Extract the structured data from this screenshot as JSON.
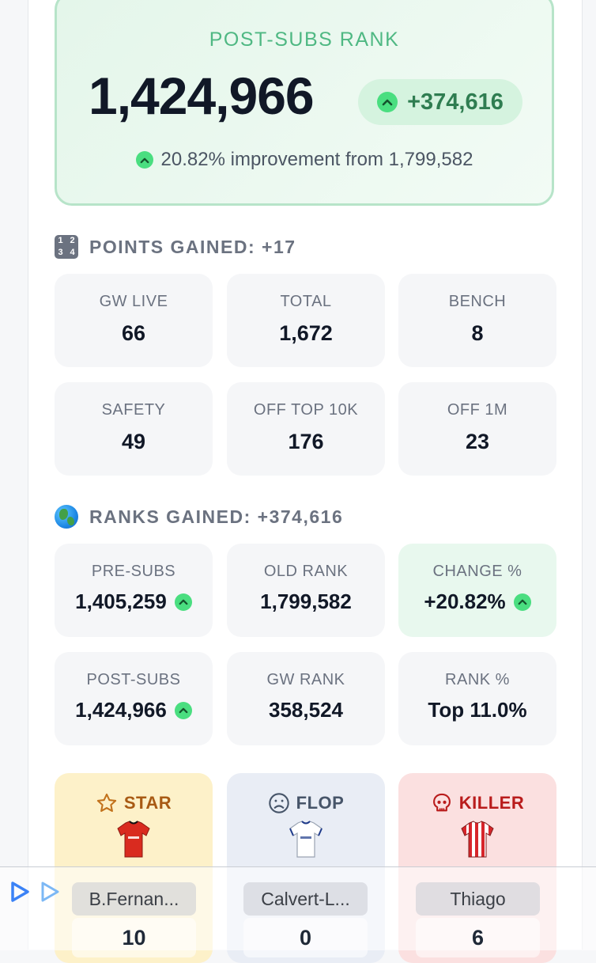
{
  "hero": {
    "label": "POST-SUBS RANK",
    "rank": "1,424,966",
    "delta": "+374,616",
    "improvement": "20.82% improvement from 1,799,582"
  },
  "points": {
    "heading": "POINTS GAINED: +17",
    "icon": "number-keypad-icon",
    "cards": [
      {
        "label": "GW LIVE",
        "value": "66"
      },
      {
        "label": "TOTAL",
        "value": "1,672"
      },
      {
        "label": "BENCH",
        "value": "8"
      },
      {
        "label": "SAFETY",
        "value": "49"
      },
      {
        "label": "OFF TOP 10K",
        "value": "176"
      },
      {
        "label": "OFF 1M",
        "value": "23"
      }
    ]
  },
  "ranks": {
    "heading": "RANKS GAINED: +374,616",
    "icon": "globe-icon",
    "cards": [
      {
        "label": "PRE-SUBS",
        "value": "1,405,259"
      },
      {
        "label": "OLD RANK",
        "value": "1,799,582"
      },
      {
        "label": "CHANGE %",
        "value": "+20.82%"
      },
      {
        "label": "POST-SUBS",
        "value": "1,424,966"
      },
      {
        "label": "GW RANK",
        "value": "358,524"
      },
      {
        "label": "RANK %",
        "value": "Top 11.0%"
      }
    ]
  },
  "players": [
    {
      "title": "STAR",
      "name": "B.Fernan...",
      "points": "10",
      "icon": "star-icon"
    },
    {
      "title": "FLOP",
      "name": "Calvert-L...",
      "points": "0",
      "icon": "frown-face-icon"
    },
    {
      "title": "KILLER",
      "name": "Thiago",
      "points": "6",
      "icon": "skull-icon"
    }
  ],
  "colors": {
    "accent_green": "#4ade80",
    "hero_bg": "#e4f6ea",
    "star_bg": "#fdf1c9",
    "flop_bg": "#e9edf5",
    "killer_bg": "#fbe0e0"
  }
}
